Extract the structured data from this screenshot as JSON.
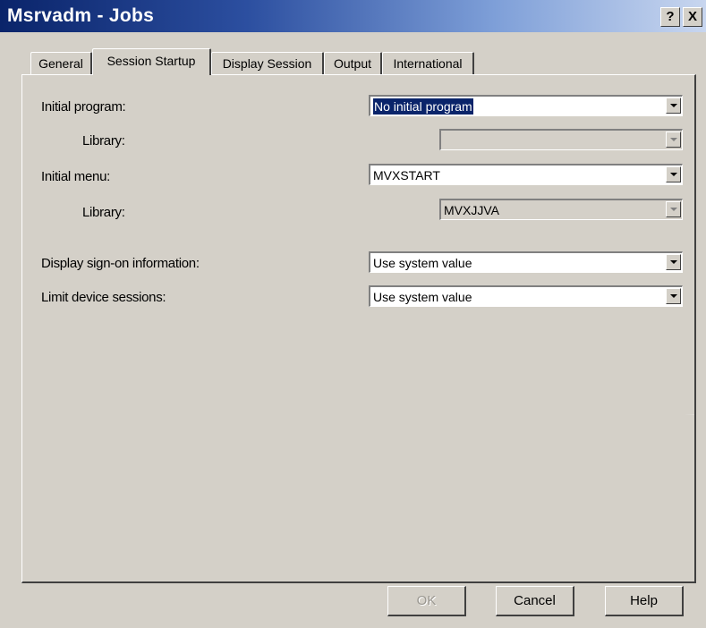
{
  "window": {
    "title": "Msrvadm - Jobs",
    "help_glyph": "?",
    "close_glyph": "X"
  },
  "tabs": [
    {
      "label": "General",
      "active": false
    },
    {
      "label": "Session Startup",
      "active": true
    },
    {
      "label": "Display Session",
      "active": false
    },
    {
      "label": "Output",
      "active": false
    },
    {
      "label": "International",
      "active": false
    }
  ],
  "form": {
    "initial_program": {
      "label": "Initial program:",
      "value": "No initial program"
    },
    "program_library": {
      "label": "Library:",
      "value": ""
    },
    "initial_menu": {
      "label": "Initial menu:",
      "value": "MVXSTART"
    },
    "menu_library": {
      "label": "Library:",
      "value": "MVXJJVA"
    },
    "display_signon": {
      "label": "Display sign-on information:",
      "value": "Use system value"
    },
    "limit_sessions": {
      "label": "Limit device sessions:",
      "value": "Use system value"
    }
  },
  "buttons": {
    "ok": "OK",
    "cancel": "Cancel",
    "help": "Help"
  },
  "colors": {
    "titlebar_start": "#0a246a",
    "titlebar_end": "#c8d6ef",
    "face": "#d4d0c8",
    "selection": "#0a246a"
  }
}
